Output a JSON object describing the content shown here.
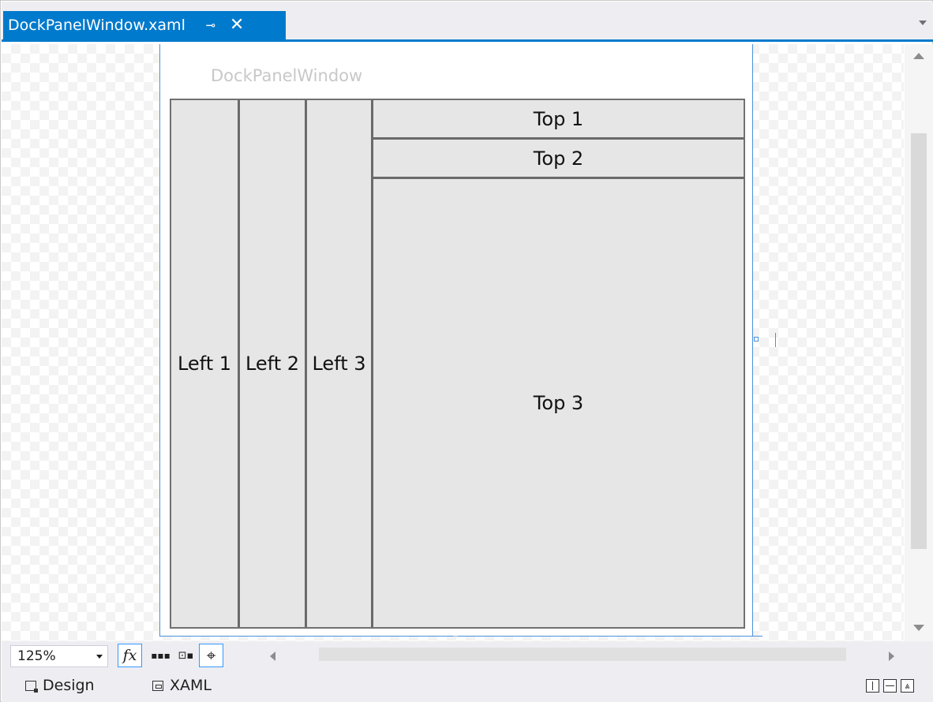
{
  "document_tab": {
    "title": "DockPanelWindow.xaml",
    "pin_glyph": "⊸",
    "close_glyph": "✕"
  },
  "designer": {
    "window_title": "DockPanelWindow",
    "dock_items": {
      "left_1": "Left 1",
      "left_2": "Left 2",
      "left_3": "Left 3",
      "top_1": "Top 1",
      "top_2": "Top 2",
      "top_3": "Top 3"
    }
  },
  "toolbar": {
    "zoom_value": "125%",
    "fx_label": "fx",
    "grid_glyph": "▪▪▪",
    "artboard_glyph": "⊡▪",
    "snap_glyph": "⌖"
  },
  "view_tabs": {
    "design_label": "Design",
    "xaml_label": "XAML"
  },
  "layout_buttons": {
    "collapse_glyph": "⩓"
  },
  "colors": {
    "accent": "#007acc",
    "chrome": "#eeeef2",
    "dock_fill": "#e6e6e6",
    "dock_border": "#707070"
  },
  "icons": [
    "pin-icon",
    "close-icon",
    "dropdown-icon",
    "fx-icon",
    "grid-icon",
    "artboard-icon",
    "snap-icon",
    "design-view-icon",
    "xaml-view-icon"
  ]
}
